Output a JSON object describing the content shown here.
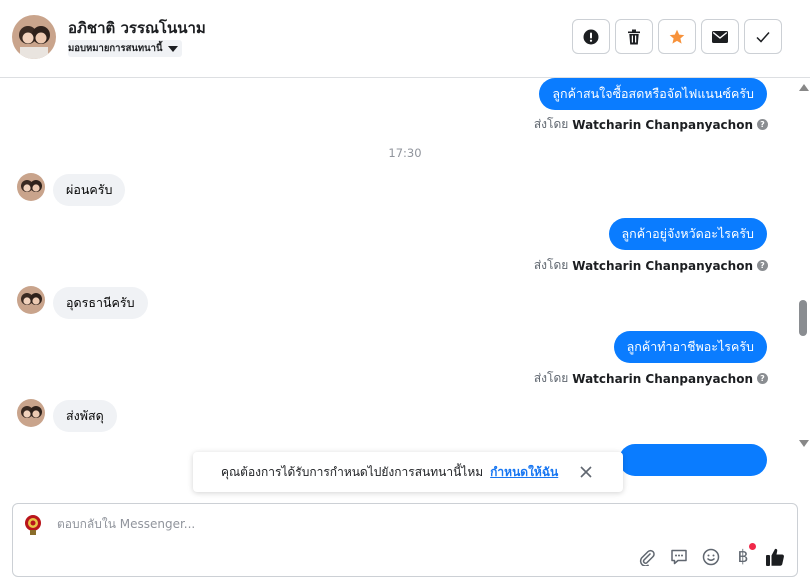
{
  "header": {
    "contact_name": "อภิชาติ วรรณโนนาม",
    "assign_label": "มอบหมายการสนทนานี้"
  },
  "actions": [
    {
      "name": "mark-spam-button",
      "icon": "alert-icon"
    },
    {
      "name": "delete-button",
      "icon": "trash-icon"
    },
    {
      "name": "star-button",
      "icon": "star-icon"
    },
    {
      "name": "mark-unread-button",
      "icon": "envelope-icon"
    },
    {
      "name": "mark-done-button",
      "icon": "check-icon"
    }
  ],
  "messages": {
    "m1": {
      "text": "ลูกค้าสนใจซื้อสดหรือจัดไฟแนนซ์ครับ",
      "sent_by_prefix": "ส่งโดย",
      "sent_by": "Watcharin Chanpanyachon"
    },
    "time": "17:30",
    "m2": {
      "text": "ผ่อนครับ"
    },
    "m3": {
      "text": "ลูกค้าอยู่จังหวัดอะไรครับ",
      "sent_by_prefix": "ส่งโดย",
      "sent_by": "Watcharin Chanpanyachon"
    },
    "m4": {
      "text": "อุดรธานีครับ"
    },
    "m5": {
      "text": "ลูกค้าทำอาชีพอะไรครับ",
      "sent_by_prefix": "ส่งโดย",
      "sent_by": "Watcharin Chanpanyachon"
    },
    "m6": {
      "text": "ส่งพัสดุ"
    }
  },
  "toast": {
    "text": "คุณต้องการได้รับการกำหนดไปยังการสนทนานี้ไหม",
    "link": "กำหนดให้ฉัน"
  },
  "composer": {
    "placeholder": "ตอบกลับใน Messenger...",
    "currency_symbol": "฿"
  },
  "colors": {
    "accent": "#0a7cff",
    "star": "#f7923b",
    "notification_dot": "#f02849"
  }
}
